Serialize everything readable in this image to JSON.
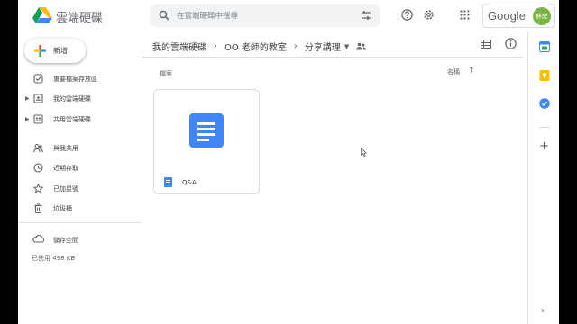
{
  "header": {
    "app_title": "雲端硬碟",
    "search_placeholder": "在雲端硬碟中搜尋",
    "account_brand": "Google",
    "avatar_text": "胖虎"
  },
  "sidebar": {
    "new_label": "新增",
    "items": [
      {
        "label": "重要檔案存放區",
        "icon": "priority-icon",
        "expandable": false
      },
      {
        "label": "我的雲端硬碟",
        "icon": "my-drive-icon",
        "expandable": true
      },
      {
        "label": "共用雲端硬碟",
        "icon": "shared-drives-icon",
        "expandable": true
      },
      {
        "label": "與我共用",
        "icon": "shared-with-me-icon",
        "expandable": false
      },
      {
        "label": "近期存取",
        "icon": "recent-icon",
        "expandable": false
      },
      {
        "label": "已加星號",
        "icon": "star-icon",
        "expandable": false
      },
      {
        "label": "垃圾桶",
        "icon": "trash-icon",
        "expandable": false
      }
    ],
    "storage_label": "儲存空間",
    "storage_used": "已使用 498 KB"
  },
  "main": {
    "breadcrumb": [
      "我的雲端硬碟",
      "OO 老師的教室",
      "分享講理"
    ],
    "section_label": "檔案",
    "sort_label": "名稱",
    "sort_direction": "ascending",
    "files": [
      {
        "name": "Q&A",
        "type": "google-docs"
      }
    ]
  },
  "side_panel": {
    "apps": [
      "calendar-icon",
      "keep-icon",
      "tasks-icon"
    ]
  },
  "colors": {
    "docs_blue": "#4285f4",
    "keep_yellow": "#fbbc04",
    "avatar_green": "#7cb342"
  }
}
